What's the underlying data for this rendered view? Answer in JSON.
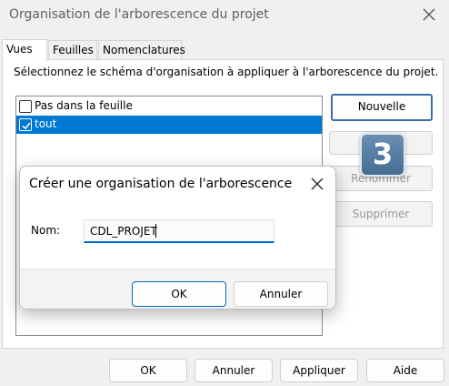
{
  "window": {
    "title": "Organisation de l'arborescence du projet",
    "close_icon": "close-icon"
  },
  "tabs": [
    {
      "label": "Vues",
      "active": true
    },
    {
      "label": "Feuilles",
      "active": false
    },
    {
      "label": "Nomenclatures",
      "active": false
    }
  ],
  "panel": {
    "instruction": "Sélectionnez le schéma d'organisation à appliquer à l'arborescence du projet.",
    "list": [
      {
        "label": "Pas dans la feuille",
        "checked": false,
        "selected": false
      },
      {
        "label": "tout",
        "checked": true,
        "selected": true
      }
    ],
    "buttons": {
      "new": "Nouvelle",
      "edit": "",
      "rename": "Renommer",
      "delete": "Supprimer"
    }
  },
  "badge": {
    "text": "3"
  },
  "dialog": {
    "title": "Créer une organisation de l'arborescence",
    "name_label": "Nom:",
    "name_value": "CDL_PROJET",
    "ok": "OK",
    "cancel": "Annuler"
  },
  "footer": {
    "ok": "OK",
    "cancel": "Annuler",
    "apply": "Appliquer",
    "help": "Aide"
  },
  "colors": {
    "accent": "#0078d4",
    "badge": "#54799f",
    "disabled_text": "#9a9a9a"
  }
}
